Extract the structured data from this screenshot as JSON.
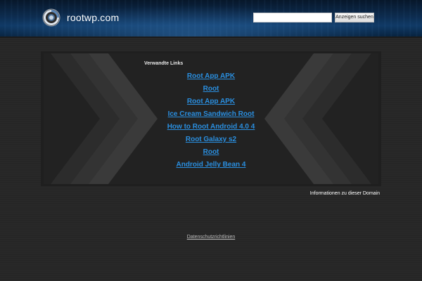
{
  "header": {
    "site_name": "rootwp.com",
    "search_placeholder": "",
    "search_button_label": "Anzeigen suchen"
  },
  "main": {
    "related_links_title": "Verwandte Links",
    "links": [
      "Root App APK",
      "Root",
      "Root App APK",
      "Ice Cream Sandwich Root",
      "How to Root Android 4.0 4",
      "Root Galaxy s2",
      "Root",
      "Android Jelly Bean 4"
    ],
    "domain_info_label": "Informationen zu dieser Domain"
  },
  "footer": {
    "privacy_label": "Datenschutzrichtlinien"
  },
  "colors": {
    "link": "#2a8fe0",
    "header_blue": "#103a66",
    "background": "#262626"
  },
  "icons": {
    "logo": "ring-logo-icon"
  }
}
